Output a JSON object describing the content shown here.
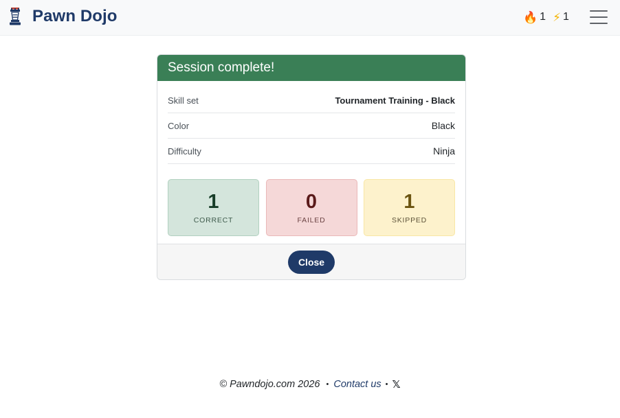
{
  "navbar": {
    "brand": "Pawn Dojo",
    "brand_icon": "chess-rook-icon",
    "streak": {
      "icon": "fire-icon",
      "value": "1"
    },
    "energy": {
      "icon": "lightning-icon",
      "value": "1"
    },
    "menu_icon": "hamburger-menu-icon"
  },
  "session": {
    "title": "Session complete!",
    "header_color": "#3a7f56",
    "rows": [
      {
        "label": "Skill set",
        "value": "Tournament Training - Black"
      },
      {
        "label": "Color",
        "value": "Black"
      },
      {
        "label": "Difficulty",
        "value": "Ninja"
      }
    ],
    "results": {
      "correct": {
        "count": "1",
        "label": "CORRECT"
      },
      "failed": {
        "count": "0",
        "label": "FAILED"
      },
      "skipped": {
        "count": "1",
        "label": "SKIPPED"
      }
    },
    "close_label": "Close"
  },
  "footer": {
    "copyright": "© Pawndojo.com 2026",
    "separator": "•",
    "contact_label": "Contact us",
    "social_icon": "x-logo-icon",
    "social_glyph": "𝕏"
  },
  "colors": {
    "brand": "#1f3a68",
    "success": "#3a7f56"
  }
}
